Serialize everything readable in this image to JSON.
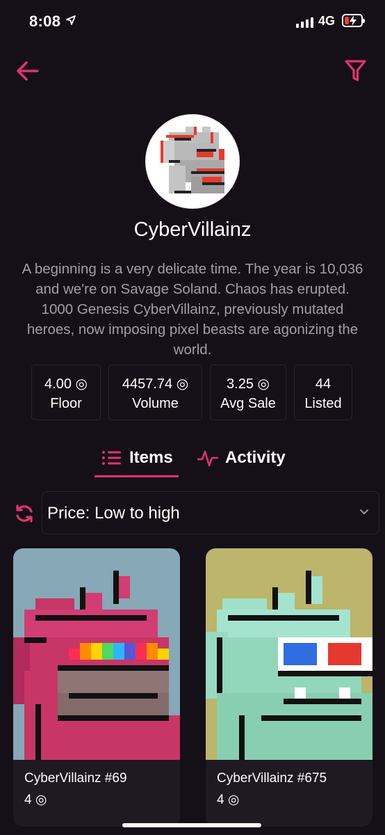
{
  "status_bar": {
    "time": "8:08",
    "network": "4G"
  },
  "colors": {
    "accent": "#e0346d",
    "background": "#150f17",
    "muted_text": "#a39da6"
  },
  "header": {
    "back_icon": "arrow-left-icon",
    "filter_icon": "filter-funnel-icon"
  },
  "collection": {
    "name": "CyberVillainz",
    "description": "A beginning is a very delicate time. The year is 10,036 and we're on Savage Soland. Chaos has erupted. 1000 Genesis CyberVillainz, previously mutated heroes, now imposing pixel beasts are agonizing the world."
  },
  "stats": [
    {
      "value": "4.00 ◎",
      "label": "Floor"
    },
    {
      "value": "4457.74 ◎",
      "label": "Volume"
    },
    {
      "value": "3.25 ◎",
      "label": "Avg Sale"
    },
    {
      "value": "44",
      "label": "Listed"
    }
  ],
  "tabs": {
    "items": "Items",
    "activity": "Activity",
    "active": "Items"
  },
  "sort": {
    "value": "Price: Low to high"
  },
  "items": [
    {
      "name": "CyberVillainz #69",
      "price": "4 ◎"
    },
    {
      "name": "CyberVillainz #675",
      "price": "4 ◎"
    }
  ]
}
